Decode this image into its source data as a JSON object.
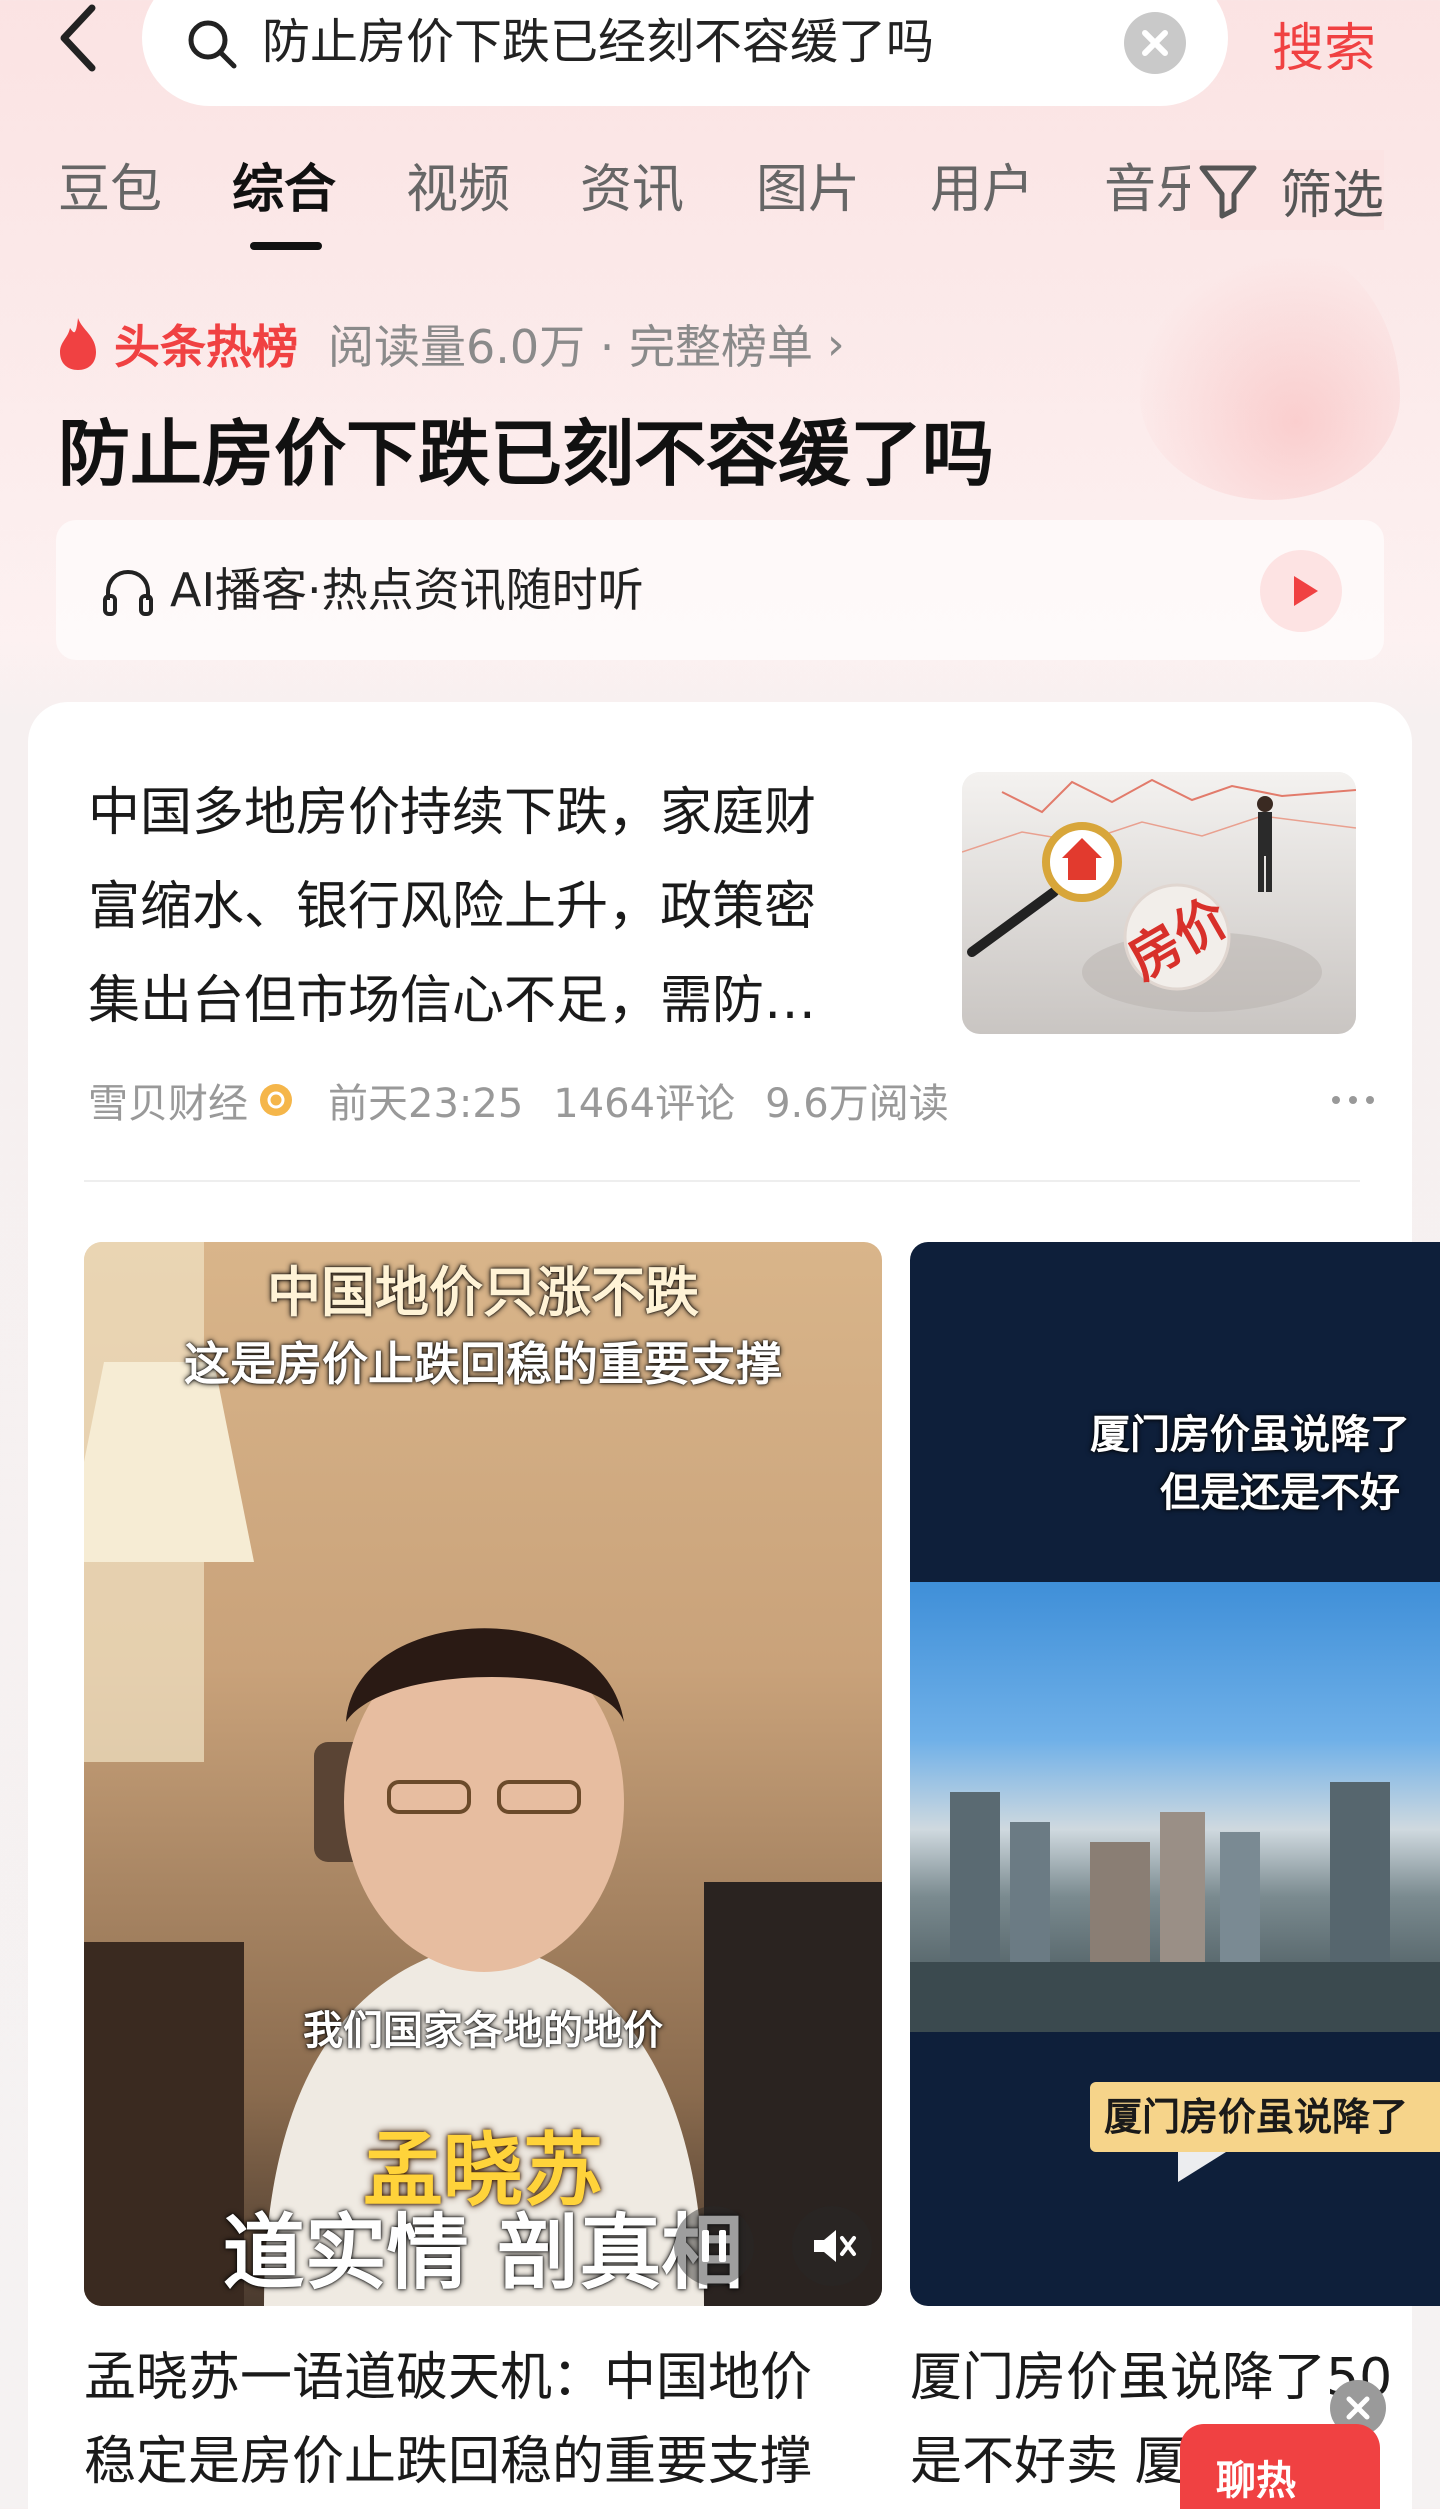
{
  "search": {
    "query": "防止房价下跌已经刻不容缓了吗",
    "submit_label": "搜索"
  },
  "tabs": [
    {
      "label": "豆包",
      "active": false
    },
    {
      "label": "综合",
      "active": true
    },
    {
      "label": "视频",
      "active": false
    },
    {
      "label": "资讯",
      "active": false
    },
    {
      "label": "图片",
      "active": false
    },
    {
      "label": "用户",
      "active": false
    },
    {
      "label": "音乐",
      "active": false
    }
  ],
  "filter_label": "筛选",
  "hot_list": {
    "badge": "头条热榜",
    "meta": "阅读量6.0万 · 完整榜单",
    "headline": "防止房价下跌已刻不容缓了吗"
  },
  "podcast": {
    "label": "AI播客·热点资讯随时听"
  },
  "article": {
    "title_lines": [
      "中国多地房价持续下跌，家庭财",
      "富缩水、银行风险上升，政策密",
      "集出台但市场信心不足，需防…"
    ],
    "source": "雪贝财经",
    "time": "前天23:25",
    "comments": "1464评论",
    "reads": "9.6万阅读",
    "thumb_text": "房价"
  },
  "videos": [
    {
      "overlay_line1": "中国地价只涨不跌",
      "overlay_line2": "这是房价止跌回稳的重要支撑",
      "subtitle": "我们国家各地的地价",
      "name": "孟晓苏",
      "tagline": "道实情 剖真相",
      "title_line1": "孟晓苏一语道破天机：中国地价",
      "title_line2": "稳定是房价止跌回稳的重要支撑"
    },
    {
      "overlay_line1": "厦门房价虽说降了",
      "overlay_line2": "但是还是不好",
      "caption": "厦门房价虽说降了",
      "title_line1": "厦门房价虽说降了50",
      "title_line2": "是不好卖 厦"
    }
  ],
  "chat_badge": "聊热",
  "colors": {
    "accent": "#f04142",
    "text": "#1a1a1a",
    "muted": "#999999"
  }
}
